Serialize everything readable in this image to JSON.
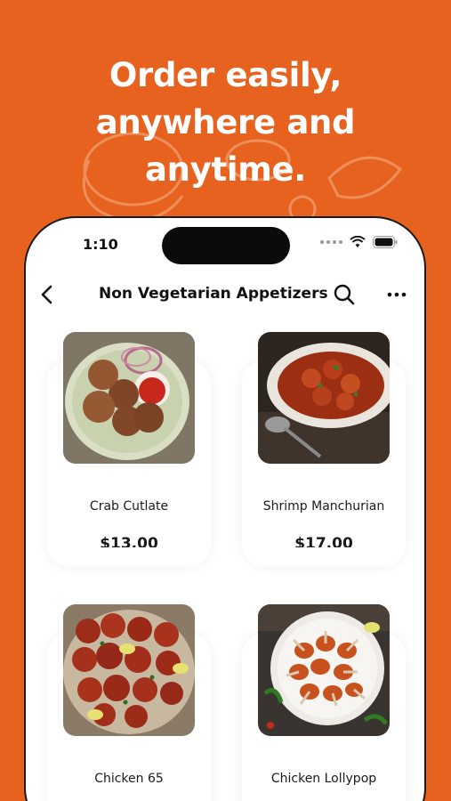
{
  "headline": {
    "line1": "Order easily,",
    "line2": "anywhere and",
    "line3": "anytime."
  },
  "status_bar": {
    "time": "1:10"
  },
  "nav": {
    "title": "Non Vegetarian Appetizers",
    "icons": [
      "chevron-left-icon",
      "search-icon",
      "more-horizontal-icon"
    ]
  },
  "products": [
    {
      "name": "Crab Cutlate",
      "price": "$13.00",
      "image": "crab-cutlet-photo"
    },
    {
      "name": "Shrimp Manchurian",
      "price": "$17.00",
      "image": "shrimp-manchurian-photo"
    },
    {
      "name": "Chicken 65",
      "price": "",
      "image": "chicken-65-photo"
    },
    {
      "name": "Chicken Lollypop",
      "price": "",
      "image": "chicken-lollypop-photo"
    }
  ],
  "colors": {
    "background": "#E8621F",
    "phone": "#FFFFFF",
    "text": "#1A1A1A"
  }
}
